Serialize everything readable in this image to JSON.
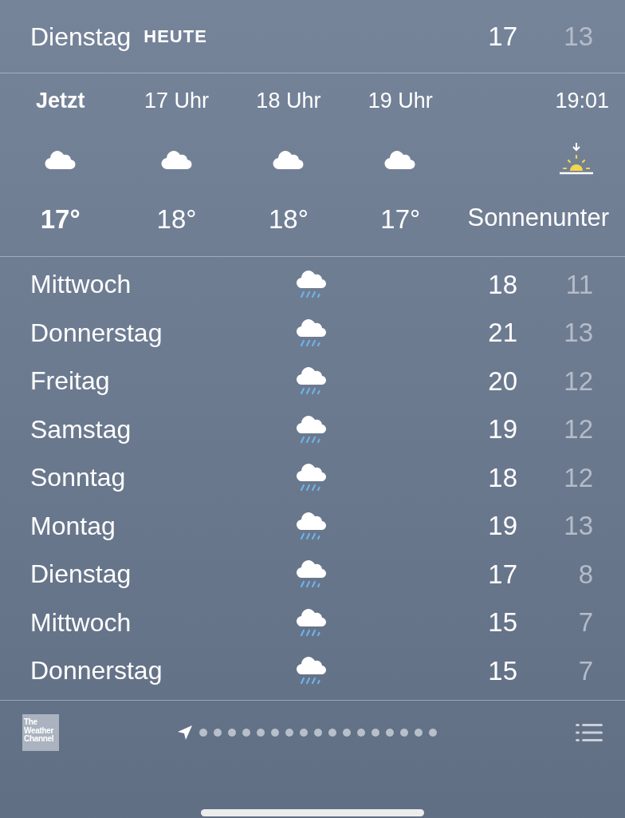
{
  "today": {
    "day": "Dienstag",
    "badge": "HEUTE",
    "high": "17",
    "low": "13"
  },
  "hourly": [
    {
      "kind": "hour",
      "time": "Jetzt",
      "temp": "17°",
      "selected": true
    },
    {
      "kind": "hour",
      "time": "17 Uhr",
      "temp": "18°",
      "selected": false
    },
    {
      "kind": "hour",
      "time": "18 Uhr",
      "temp": "18°",
      "selected": false
    },
    {
      "kind": "hour",
      "time": "19 Uhr",
      "temp": "17°",
      "selected": false
    },
    {
      "kind": "sunset",
      "time": "19:01",
      "temp": "Sonnenunter"
    }
  ],
  "daily": [
    {
      "day": "Mittwoch",
      "high": "18",
      "low": "11"
    },
    {
      "day": "Donnerstag",
      "high": "21",
      "low": "13"
    },
    {
      "day": "Freitag",
      "high": "20",
      "low": "12"
    },
    {
      "day": "Samstag",
      "high": "19",
      "low": "12"
    },
    {
      "day": "Sonntag",
      "high": "18",
      "low": "12"
    },
    {
      "day": "Montag",
      "high": "19",
      "low": "13"
    },
    {
      "day": "Dienstag",
      "high": "17",
      "low": "8"
    },
    {
      "day": "Mittwoch",
      "high": "15",
      "low": "7"
    },
    {
      "day": "Donnerstag",
      "high": "15",
      "low": "7"
    }
  ],
  "footer": {
    "logo": [
      "The",
      "Weather",
      "Channel"
    ],
    "pages": [
      {
        "kind": "location",
        "selected": true
      },
      {
        "kind": "dot",
        "selected": false
      },
      {
        "kind": "dot",
        "selected": false
      },
      {
        "kind": "dot",
        "selected": false
      },
      {
        "kind": "dot",
        "selected": false
      },
      {
        "kind": "dot",
        "selected": false
      },
      {
        "kind": "dot",
        "selected": false
      },
      {
        "kind": "dot",
        "selected": false
      },
      {
        "kind": "dot",
        "selected": false
      },
      {
        "kind": "dot",
        "selected": false
      },
      {
        "kind": "dot",
        "selected": false
      },
      {
        "kind": "dot",
        "selected": false
      },
      {
        "kind": "dot",
        "selected": false
      },
      {
        "kind": "dot",
        "selected": false
      },
      {
        "kind": "dot",
        "selected": false
      },
      {
        "kind": "dot",
        "selected": false
      },
      {
        "kind": "dot",
        "selected": false
      },
      {
        "kind": "dot",
        "selected": false
      }
    ]
  }
}
